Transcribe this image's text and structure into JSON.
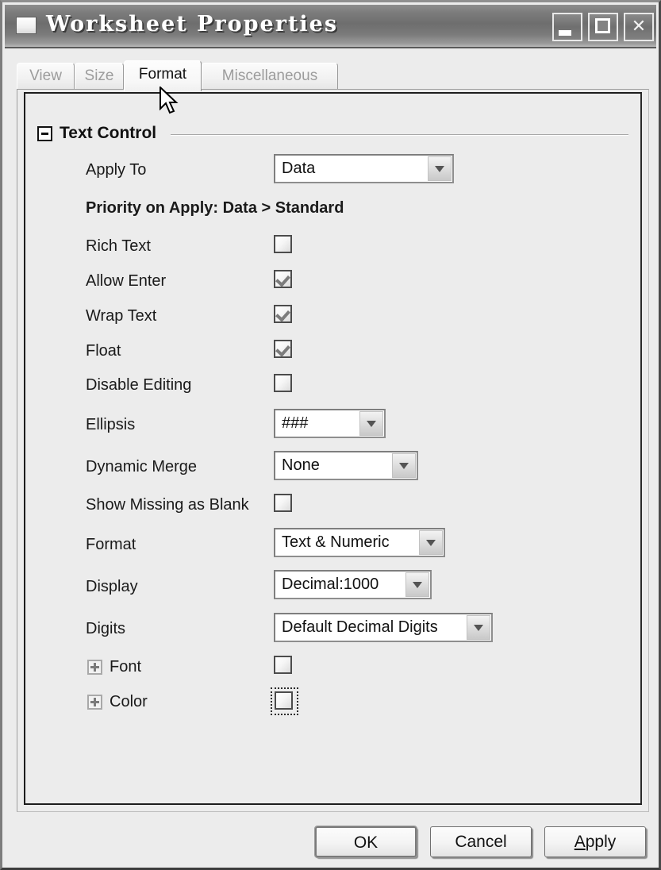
{
  "window": {
    "title": "Worksheet Properties",
    "icon": "window-square-icon",
    "controls": {
      "minimize": "minimize-icon",
      "maximize": "maximize-icon",
      "close": "✕"
    }
  },
  "tabs": [
    {
      "label": "View",
      "selected": false
    },
    {
      "label": "Size",
      "selected": false
    },
    {
      "label": "Format",
      "selected": true
    },
    {
      "label": "Miscellaneous",
      "selected": false
    }
  ],
  "group": {
    "title": "Text Control",
    "expanded": true,
    "toggle_glyph": "minus"
  },
  "fields": {
    "apply_to": {
      "label": "Apply To",
      "value": "Data"
    },
    "priority_note": "Priority on Apply: Data > Standard",
    "rich_text": {
      "label": "Rich Text",
      "checked": false
    },
    "allow_enter": {
      "label": "Allow Enter",
      "checked": true
    },
    "wrap_text": {
      "label": "Wrap Text",
      "checked": true
    },
    "float": {
      "label": "Float",
      "checked": true
    },
    "disable_editing": {
      "label": "Disable Editing",
      "checked": false
    },
    "ellipsis": {
      "label": "Ellipsis",
      "value": "###"
    },
    "dynamic_merge": {
      "label": "Dynamic Merge",
      "value": "None"
    },
    "show_missing_as_blank": {
      "label": "Show Missing as Blank",
      "checked": false
    },
    "format": {
      "label": "Format",
      "value": "Text & Numeric"
    },
    "display": {
      "label": "Display",
      "value": "Decimal:1000"
    },
    "digits": {
      "label": "Digits",
      "value": "Default Decimal Digits"
    },
    "font": {
      "label": "Font",
      "checked": false,
      "expander": "plus"
    },
    "color": {
      "label": "Color",
      "checked": false,
      "expander": "plus",
      "focused": true
    }
  },
  "buttons": {
    "ok": "OK",
    "cancel": "Cancel",
    "apply_accel": "A",
    "apply_rest": "pply"
  },
  "colors": {
    "dialog_face": "#ececec",
    "title_bar": "#6e6e6e",
    "text": "#1a1a1a",
    "disabled_tab_text": "#9c9c9c",
    "check_mark": "#7c7c7c"
  }
}
